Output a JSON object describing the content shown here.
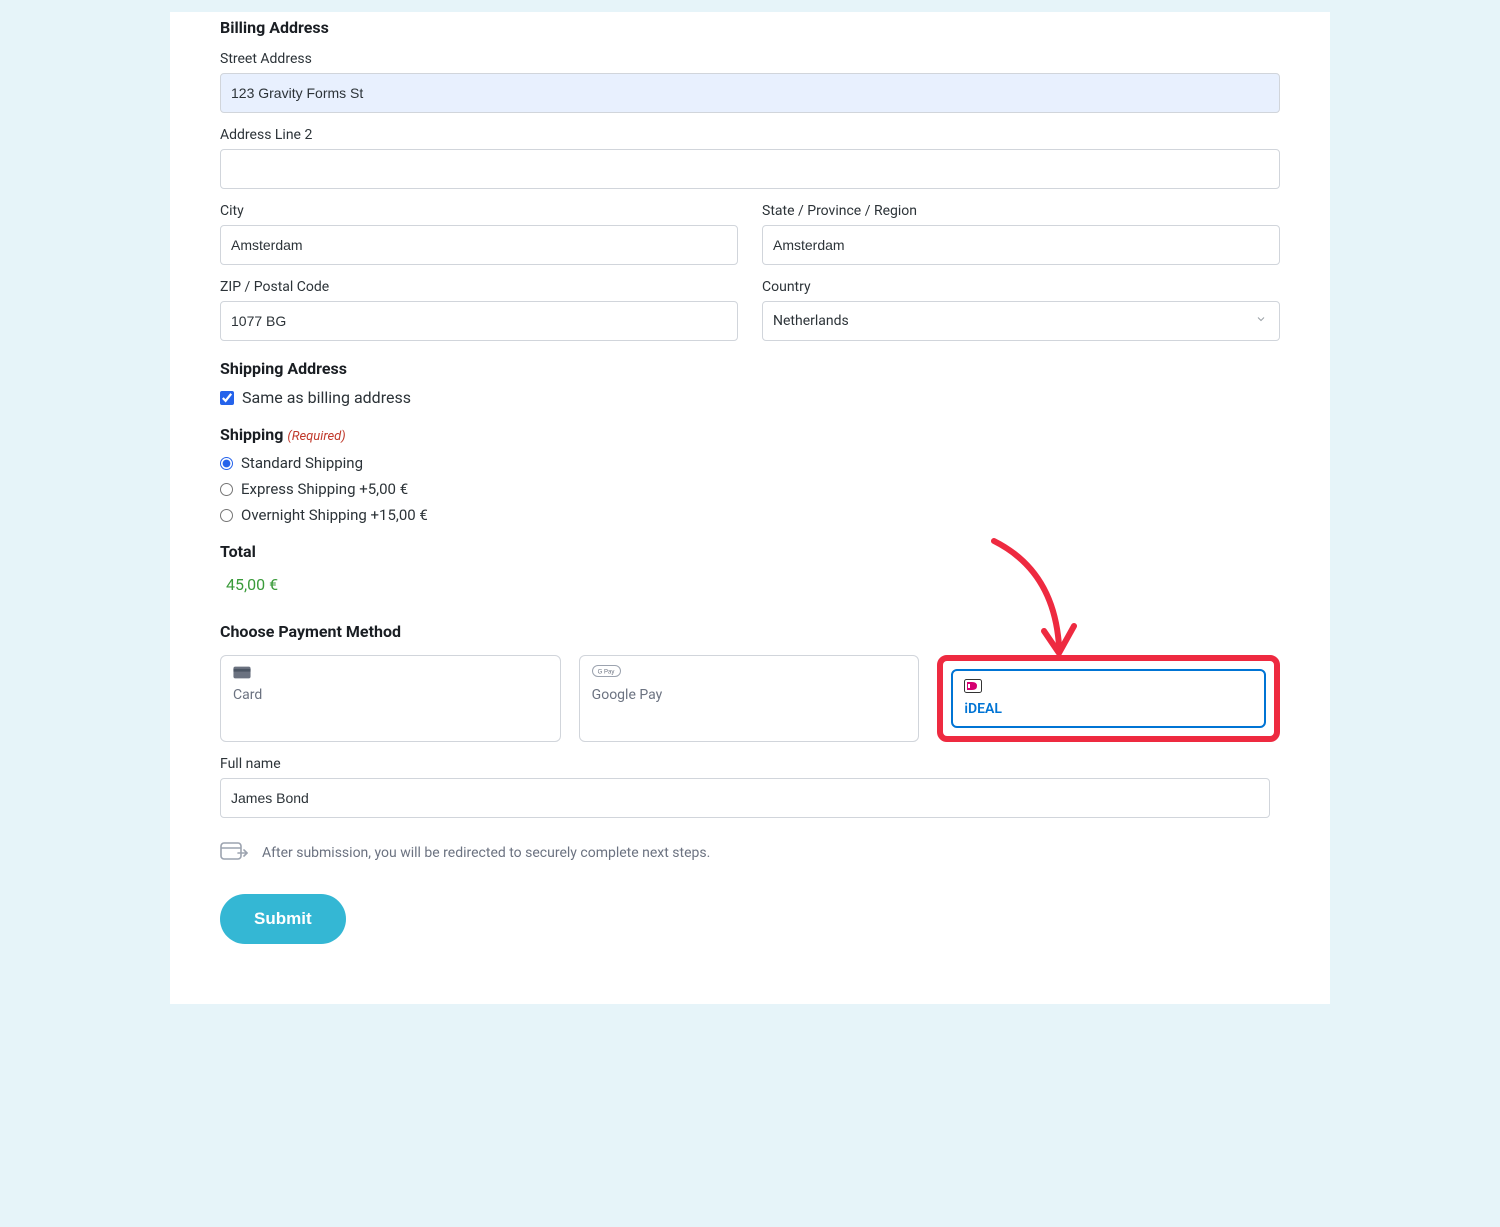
{
  "billing": {
    "heading": "Billing Address",
    "street_label": "Street Address",
    "street_value": "123 Gravity Forms St",
    "line2_label": "Address Line 2",
    "line2_value": "",
    "city_label": "City",
    "city_value": "Amsterdam",
    "state_label": "State / Province / Region",
    "state_value": "Amsterdam",
    "zip_label": "ZIP / Postal Code",
    "zip_value": "1077 BG",
    "country_label": "Country",
    "country_value": "Netherlands"
  },
  "shipping_addr": {
    "heading": "Shipping Address",
    "same_label": "Same as billing address",
    "same_checked": true
  },
  "shipping": {
    "heading": "Shipping",
    "required_text": "(Required)",
    "options": [
      {
        "label": "Standard Shipping",
        "checked": true
      },
      {
        "label": "Express Shipping +5,00 €",
        "checked": false
      },
      {
        "label": "Overnight Shipping +15,00 €",
        "checked": false
      }
    ]
  },
  "total": {
    "heading": "Total",
    "value": "45,00 €"
  },
  "payment": {
    "heading": "Choose Payment Method",
    "methods": [
      {
        "id": "card",
        "label": "Card",
        "selected": false
      },
      {
        "id": "googlepay",
        "label": "Google Pay",
        "selected": false
      },
      {
        "id": "ideal",
        "label": "iDEAL",
        "selected": true
      }
    ],
    "fullname_label": "Full name",
    "fullname_value": "James Bond",
    "redirect_note": "After submission, you will be redirected to securely complete next steps."
  },
  "submit_label": "Submit",
  "annotation": {
    "highlight_target": "ideal",
    "arrow_description": "hand-drawn red arrow pointing to iDEAL option"
  }
}
